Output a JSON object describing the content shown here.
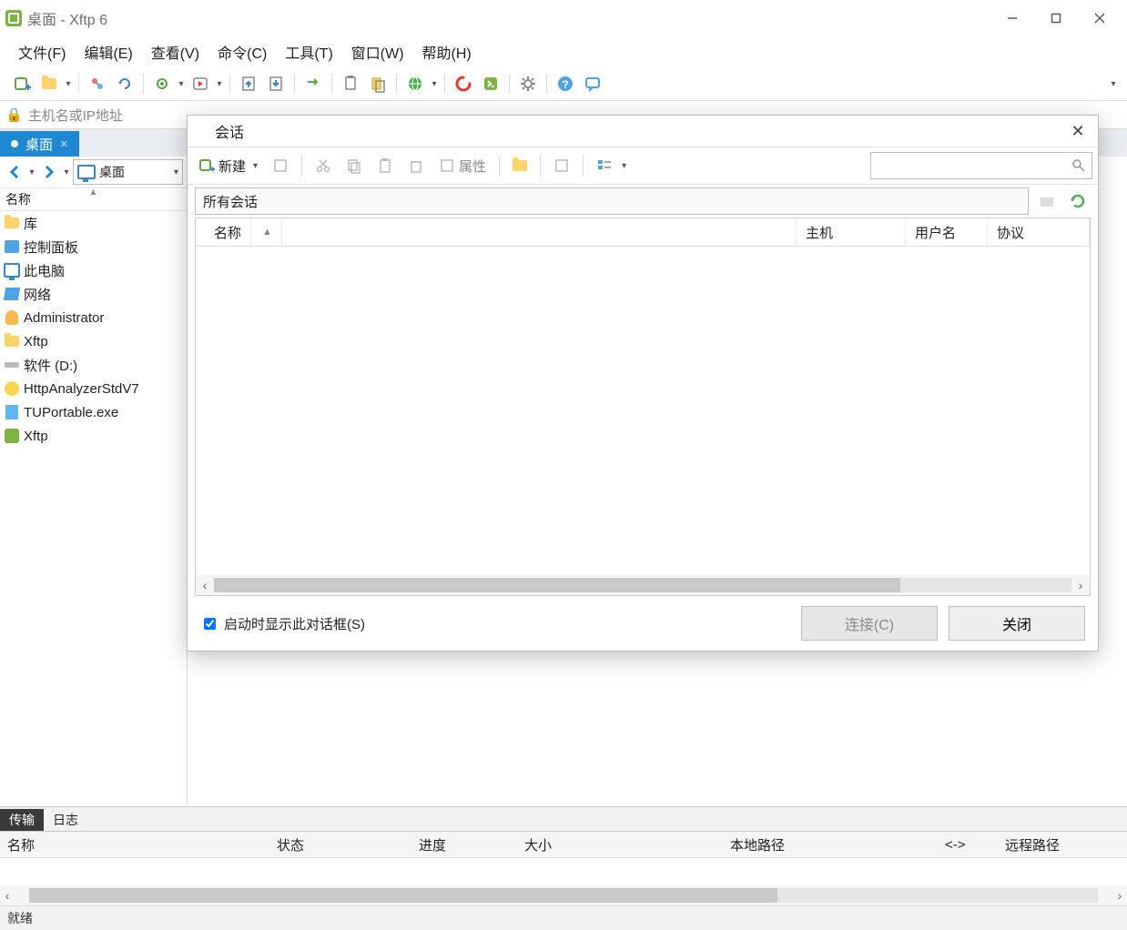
{
  "title": "桌面 - Xftp 6",
  "menu": {
    "file": "文件(F)",
    "edit": "编辑(E)",
    "view": "查看(V)",
    "cmd": "命令(C)",
    "tool": "工具(T)",
    "win": "窗口(W)",
    "help": "帮助(H)"
  },
  "addressbar": {
    "placeholder": "主机名或IP地址"
  },
  "tab": {
    "label": "桌面"
  },
  "nav": {
    "location": "桌面"
  },
  "sidebar": {
    "header": "名称",
    "items": [
      {
        "name": "库"
      },
      {
        "name": "控制面板"
      },
      {
        "name": "此电脑"
      },
      {
        "name": "网络"
      },
      {
        "name": "Administrator"
      },
      {
        "name": "Xftp"
      },
      {
        "name": "软件 (D:)"
      },
      {
        "name": "HttpAnalyzerStdV7"
      },
      {
        "name": "TUPortable.exe"
      },
      {
        "name": "Xftp"
      }
    ]
  },
  "bottom": {
    "tabs": {
      "transfer": "传输",
      "log": "日志"
    },
    "cols": {
      "name": "名称",
      "status": "状态",
      "progress": "进度",
      "size": "大小",
      "local": "本地路径",
      "dir": "<->",
      "remote": "远程路径"
    }
  },
  "status": "就绪",
  "dialog": {
    "title": "会话",
    "toolbar": {
      "new": "新建",
      "props": "属性"
    },
    "path": "所有会话",
    "cols": {
      "name": "名称",
      "host": "主机",
      "user": "用户名",
      "proto": "协议"
    },
    "checkbox": "启动时显示此对话框(S)",
    "connect": "连接(C)",
    "close": "关闭"
  }
}
